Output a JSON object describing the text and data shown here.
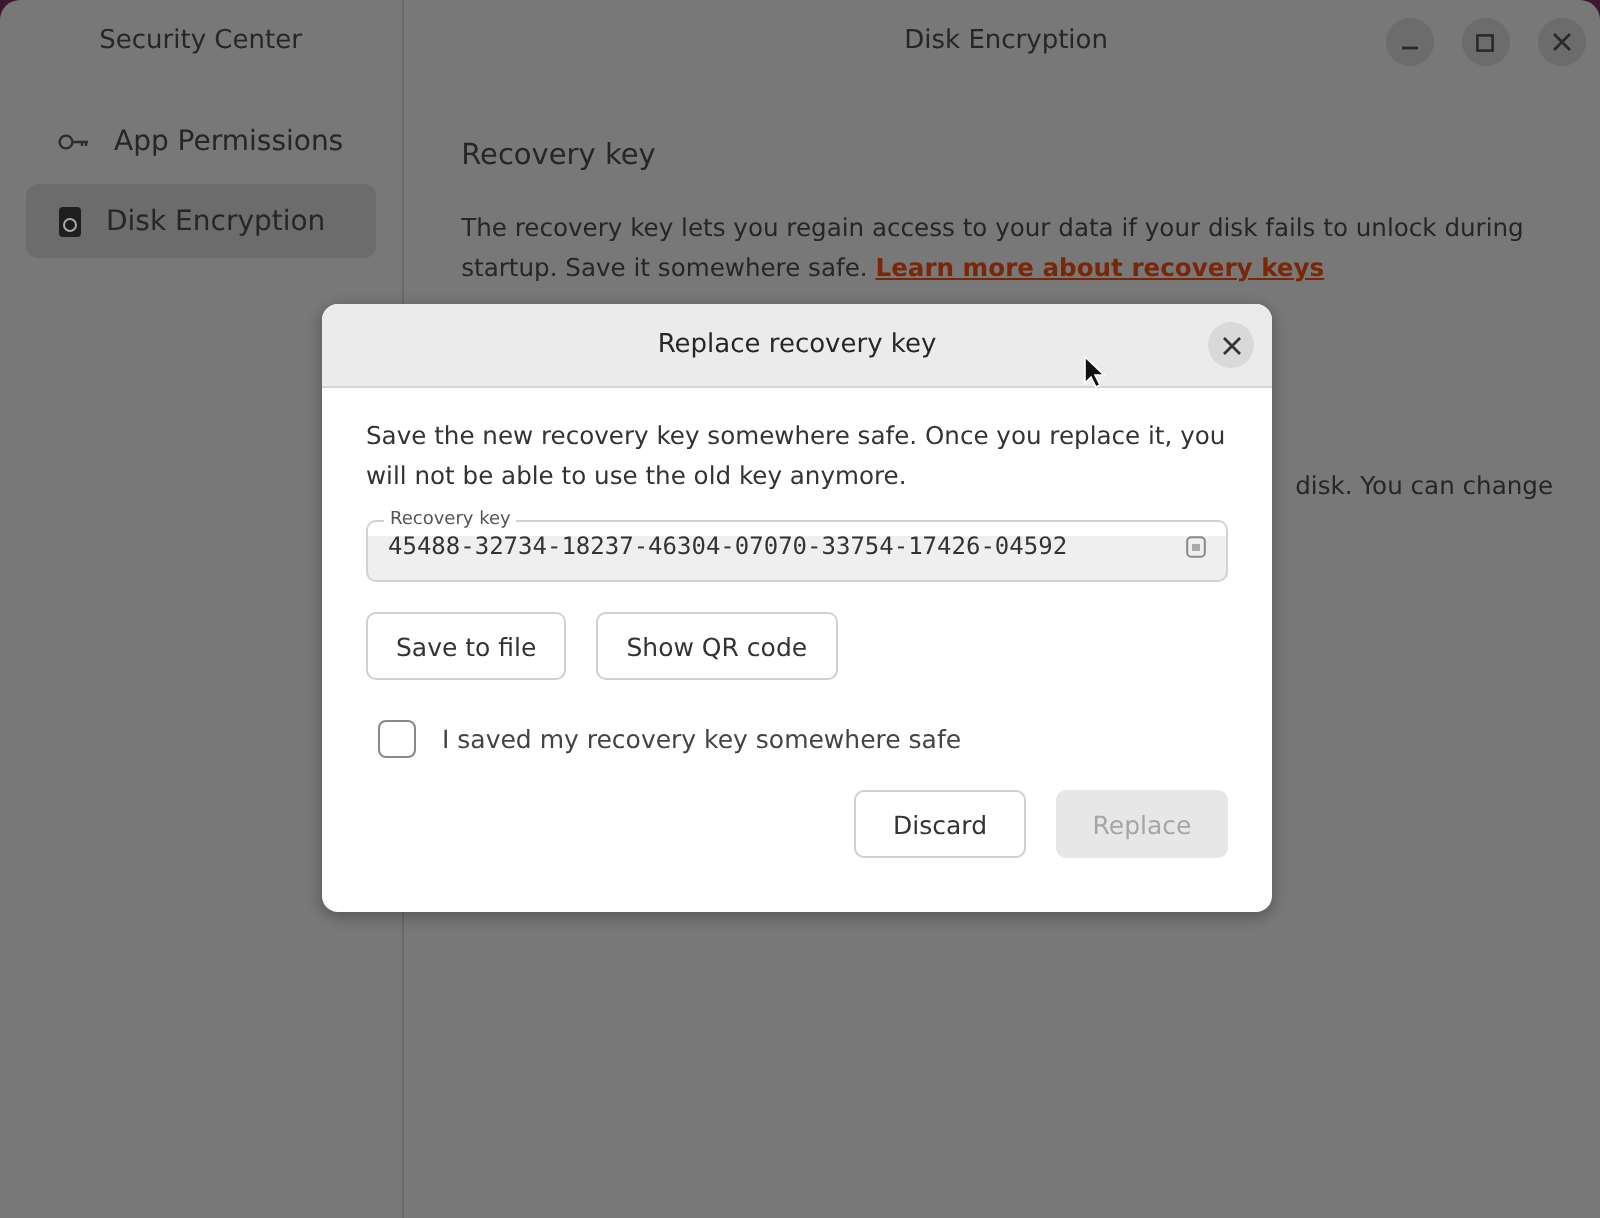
{
  "sidebar": {
    "title": "Security Center",
    "items": [
      {
        "label": "App Permissions",
        "selected": false
      },
      {
        "label": "Disk Encryption",
        "selected": true
      }
    ]
  },
  "main": {
    "title": "Disk Encryption",
    "section_title": "Recovery key",
    "description": "The recovery key lets you regain access to your data if your disk fails to unlock during startup. Save it somewhere safe.",
    "link": "Learn more about recovery keys",
    "partial_text": "disk. You can change"
  },
  "dialog": {
    "title": "Replace recovery key",
    "message": "Save the new recovery key somewhere safe. Once you replace it, you will not be able to use the old key anymore.",
    "field": {
      "label": "Recovery key",
      "value": "45488-32734-18237-46304-07070-33754-17426-04592"
    },
    "actions": [
      "Save to file",
      "Show QR code"
    ],
    "checkbox": {
      "label": "I saved my recovery key somewhere safe",
      "checked": false
    },
    "buttons": [
      {
        "label": "Discard",
        "disabled": false
      },
      {
        "label": "Replace",
        "disabled": true
      }
    ]
  }
}
